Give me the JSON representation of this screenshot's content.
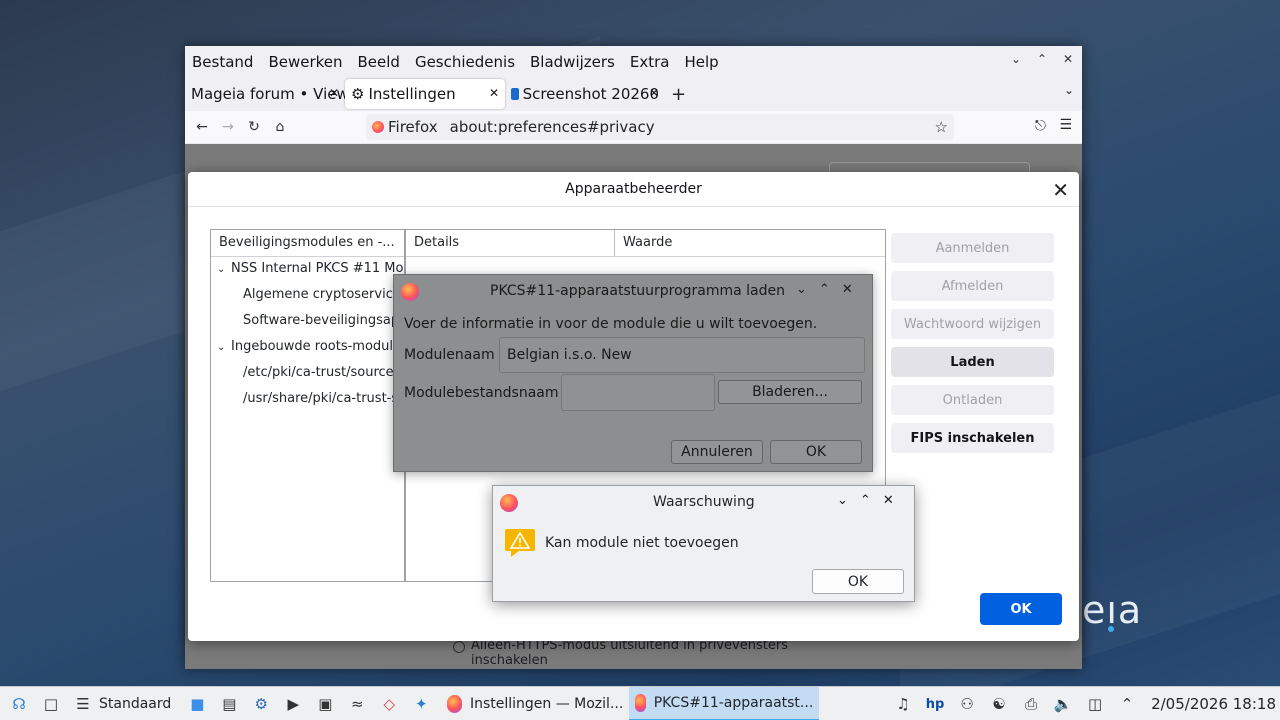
{
  "firefox": {
    "menu": [
      "Bestand",
      "Bewerken",
      "Beeld",
      "Geschiedenis",
      "Bladwijzers",
      "Extra",
      "Help"
    ],
    "tabs": [
      {
        "label": "Mageia forum • View",
        "icon": "mageia-icon"
      },
      {
        "label": "Instellingen",
        "icon": "gear-icon"
      },
      {
        "label": "Screenshot 20260",
        "icon": "postimage-icon"
      }
    ],
    "url_identity": "Firefox",
    "url": "about:preferences#privacy",
    "bg_text_line1": "Alleen-HTTPS-modus uitsluitend in privévensters",
    "bg_text_line2": "inschakelen"
  },
  "device_manager": {
    "title": "Apparaatbeheerder",
    "modules_header": "Beveiligingsmodules en -...",
    "details_header": "Details",
    "value_header": "Waarde",
    "modules": [
      {
        "label": "NSS Internal PKCS #11 Mo...",
        "level": 1
      },
      {
        "label": "Algemene cryptoservice...",
        "level": 2
      },
      {
        "label": "Software-beveiligingsap...",
        "level": 2
      },
      {
        "label": "Ingebouwde roots-modul...",
        "level": 1
      },
      {
        "label": "/etc/pki/ca-trust/source",
        "level": 2
      },
      {
        "label": "/usr/share/pki/ca-trust-s",
        "level": 2
      }
    ],
    "buttons": {
      "login": "Aanmelden",
      "logout": "Afmelden",
      "change_password": "Wachtwoord wijzigen",
      "load": "Laden",
      "unload": "Ontladen",
      "fips": "FIPS inschakelen"
    },
    "ok": "OK"
  },
  "pkcs_dialog": {
    "title": "PKCS#11-apparaatstuurprogramma laden",
    "info": "Voer de informatie in voor de module die u wilt toevoegen.",
    "module_name_label": "Modulenaam",
    "module_name_value": "Belgian i.s.o. New",
    "module_file_label": "Modulebestandsnaam",
    "module_file_value": "",
    "browse": "Bladeren...",
    "cancel": "Annuleren",
    "ok": "OK"
  },
  "warning_dialog": {
    "title": "Waarschuwing",
    "message": "Kan module niet toevoegen",
    "ok": "OK"
  },
  "taskbar": {
    "workspace": "Standaard",
    "tasks": [
      {
        "label": "Instellingen — Mozil...",
        "active": false
      },
      {
        "label": "PKCS#11-apparaatst...",
        "active": true
      }
    ],
    "clock": "2/05/2026  18:18"
  },
  "desktop": {
    "logo_text": "eıa"
  },
  "colors": {
    "accent": "#0061e0",
    "task_active": "#c3dcf4"
  }
}
